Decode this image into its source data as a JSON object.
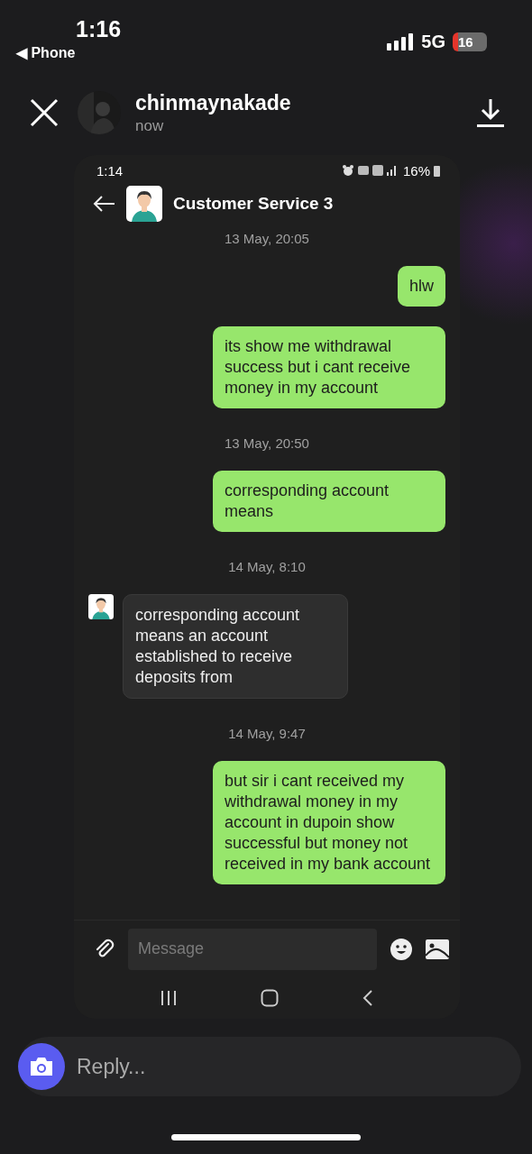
{
  "status_bar": {
    "time": "1:16",
    "back_label": "◀ Phone",
    "network": "5G",
    "battery": "16",
    "battery_low": true
  },
  "story_header": {
    "username": "chinmaynakade",
    "time": "now"
  },
  "screenshot": {
    "status_bar": {
      "time": "1:14",
      "battery": "16%"
    },
    "chat_title": "Customer Service 3",
    "messages": [
      {
        "kind": "date",
        "text": "13 May, 20:05"
      },
      {
        "kind": "sent",
        "text": "hlw"
      },
      {
        "kind": "sent",
        "text": "its show me withdrawal success but i cant receive money in my account"
      },
      {
        "kind": "date",
        "text": "13 May, 20:50"
      },
      {
        "kind": "sent",
        "text": "corresponding account means"
      },
      {
        "kind": "date",
        "text": "14 May, 8:10"
      },
      {
        "kind": "received",
        "text": "corresponding account means an account established to receive deposits from"
      },
      {
        "kind": "date",
        "text": "14 May, 9:47"
      },
      {
        "kind": "sent",
        "text": "but sir i cant received my withdrawal money in my account in dupoin show successful but money not received in my bank account"
      }
    ],
    "composer": {
      "placeholder": "Message"
    }
  },
  "reply": {
    "placeholder": "Reply..."
  }
}
